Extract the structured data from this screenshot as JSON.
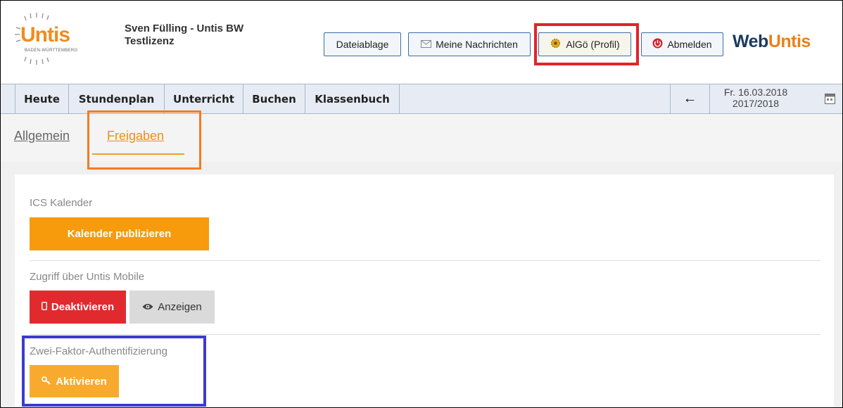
{
  "header": {
    "logo_text": "Untis",
    "logo_subtext": "BADEN-WÜRTTEMBERG",
    "user_name": "Sven Fülling - Untis BW\nTestlizenz",
    "buttons": {
      "files": "Dateiablage",
      "messages": "Meine Nachrichten",
      "profile": "AlGö (Profil)",
      "logout": "Abmelden"
    },
    "brand_part1": "Web",
    "brand_part2": "Untis"
  },
  "nav": {
    "items": [
      "Heute",
      "Stundenplan",
      "Unterricht",
      "Buchen",
      "Klassenbuch"
    ],
    "back_icon": "←",
    "date": "Fr. 16.03.2018",
    "school_year": "2017/2018"
  },
  "tabs": {
    "general": "Allgemein",
    "shares": "Freigaben"
  },
  "sections": {
    "ics": {
      "label": "ICS Kalender",
      "button": "Kalender publizieren"
    },
    "mobile": {
      "label": "Zugriff über Untis Mobile",
      "deactivate": "Deaktivieren",
      "show": "Anzeigen"
    },
    "twofa": {
      "label": "Zwei-Faktor-Authentifizierung",
      "activate": "Aktivieren"
    }
  },
  "colors": {
    "accent_orange": "#f79a0c",
    "danger_red": "#e12a2e",
    "brand_navy": "#1a3a5e",
    "highlight_red": "#e3222b",
    "highlight_orange": "#f47b20",
    "highlight_blue": "#3d3bd0"
  },
  "icons": {
    "messages": "envelope-icon",
    "profile": "gear-icon",
    "logout": "power-icon",
    "back": "arrow-left-icon",
    "calendar": "calendar-icon",
    "deactivate": "phone-icon",
    "show": "eye-icon",
    "activate": "key-icon"
  }
}
